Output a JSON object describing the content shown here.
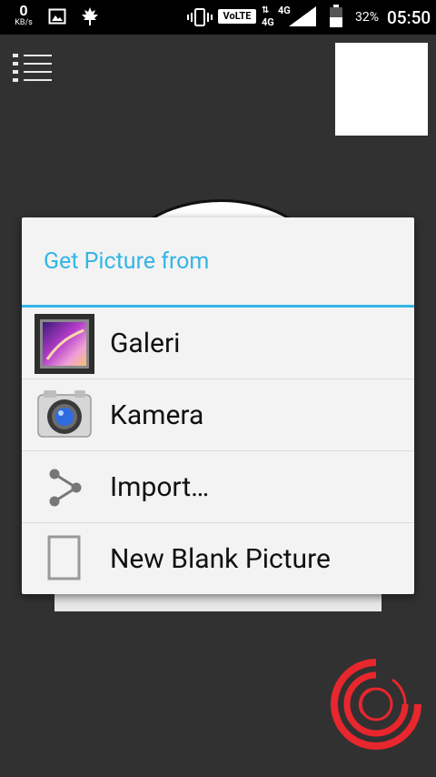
{
  "status_bar": {
    "kbs_value": "0",
    "kbs_unit": "KB/s",
    "volte_label": "VoLTE",
    "net_1": "4G",
    "net_2": "4G",
    "battery_percent": "32%",
    "time": "05:50"
  },
  "dialog": {
    "title": "Get Picture from",
    "items": [
      {
        "label": "Galeri",
        "icon": "gallery-icon"
      },
      {
        "label": "Kamera",
        "icon": "camera-icon"
      },
      {
        "label": "Import…",
        "icon": "share-icon"
      },
      {
        "label": "New Blank Picture",
        "icon": "blank-page-icon"
      }
    ]
  },
  "colors": {
    "accent": "#33b5e5",
    "background": "#313131",
    "dialog_bg": "#f3f3f3",
    "logo_red": "#e8262d"
  }
}
